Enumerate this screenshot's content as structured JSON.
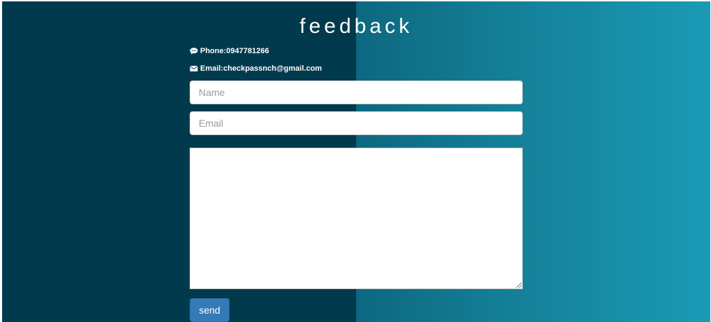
{
  "page": {
    "title": "feedback",
    "colors": {
      "left_background": "#023a4d",
      "right_gradient_start": "#0d6880",
      "right_gradient_end": "#1b9ab6",
      "button": "#337ab7",
      "text": "#ffffff"
    }
  },
  "contact": {
    "phone_icon": "comment-icon",
    "phone_text": "Phone:0947781266",
    "email_icon": "envelope-icon",
    "email_text": "Email:checkpassnch@gmail.com"
  },
  "form": {
    "name_placeholder": "Name",
    "name_value": "",
    "email_placeholder": "Email",
    "email_value": "",
    "message_value": "",
    "send_label": "send"
  }
}
